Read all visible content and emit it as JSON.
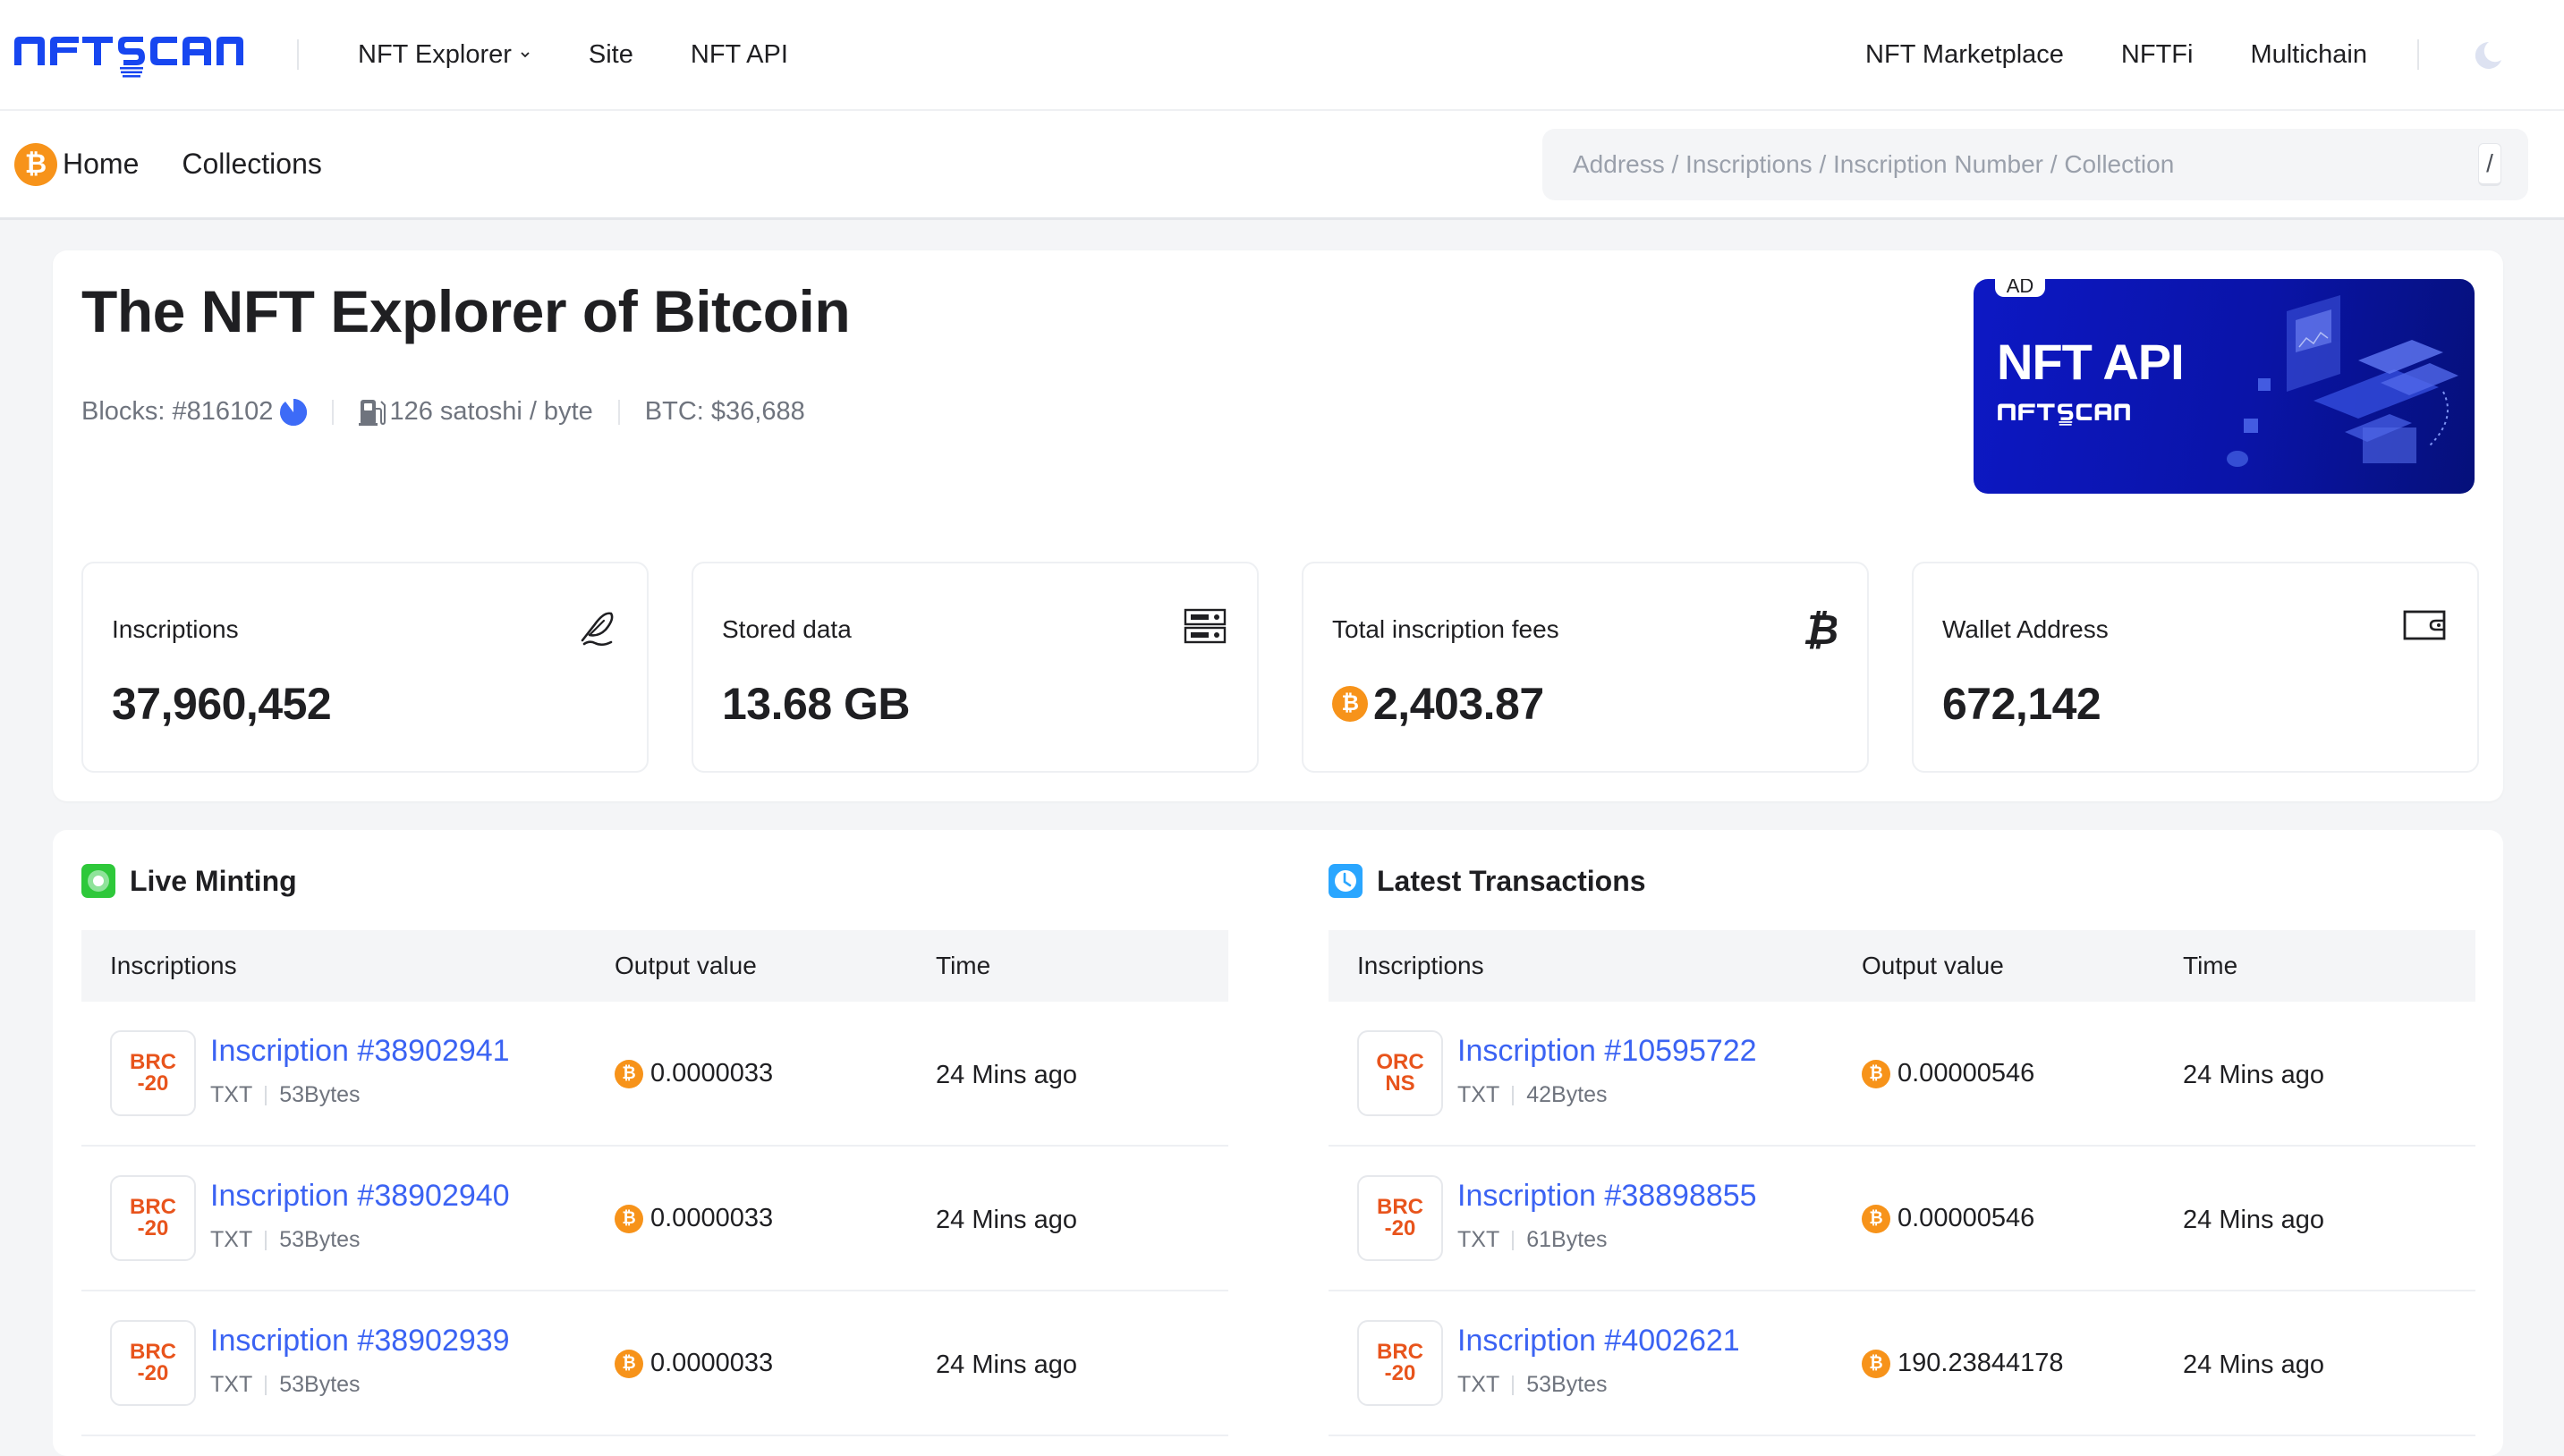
{
  "header": {
    "brand": "NFTSCAN",
    "nav_left": [
      {
        "label": "NFT Explorer",
        "has_dropdown": true
      },
      {
        "label": "Site"
      },
      {
        "label": "NFT API"
      }
    ],
    "nav_right": [
      {
        "label": "NFT Marketplace"
      },
      {
        "label": "NFTFi"
      },
      {
        "label": "Multichain"
      }
    ],
    "theme_toggle_icon": "moon-icon"
  },
  "subnav": {
    "chain_icon": "bitcoin-icon",
    "items": [
      {
        "label": "Home"
      },
      {
        "label": "Collections"
      }
    ],
    "search": {
      "placeholder": "Address / Inscriptions / Inscription Number / Collection",
      "value": "",
      "shortcut": "/"
    }
  },
  "hero": {
    "title": "The NFT Explorer of Bitcoin",
    "stats": {
      "blocks": "Blocks: #816102",
      "gas": "126 satoshi / byte",
      "btc_price": "BTC: $36,688"
    },
    "ad": {
      "tag": "AD",
      "title": "NFT API",
      "brand": "NFTSCAN"
    },
    "cards": [
      {
        "label": "Inscriptions",
        "value": "37,960,452",
        "icon": "quill-icon"
      },
      {
        "label": "Stored data",
        "value": "13.68 GB",
        "icon": "server-icon"
      },
      {
        "label": "Total inscription fees",
        "value": "2,403.87",
        "icon": "bitcoin-symbol-icon",
        "has_btc_coin": true
      },
      {
        "label": "Wallet Address",
        "value": "672,142",
        "icon": "wallet-icon"
      }
    ]
  },
  "live_minting": {
    "title": "Live Minting",
    "columns": [
      "Inscriptions",
      "Output value",
      "Time"
    ],
    "rows": [
      {
        "badge": [
          "BRC",
          "-20"
        ],
        "name": "Inscription #38902941",
        "type": "TXT",
        "size": "53Bytes",
        "output": "0.0000033",
        "time": "24 Mins ago"
      },
      {
        "badge": [
          "BRC",
          "-20"
        ],
        "name": "Inscription #38902940",
        "type": "TXT",
        "size": "53Bytes",
        "output": "0.0000033",
        "time": "24 Mins ago"
      },
      {
        "badge": [
          "BRC",
          "-20"
        ],
        "name": "Inscription #38902939",
        "type": "TXT",
        "size": "53Bytes",
        "output": "0.0000033",
        "time": "24 Mins ago"
      }
    ]
  },
  "latest_transactions": {
    "title": "Latest Transactions",
    "columns": [
      "Inscriptions",
      "Output value",
      "Time"
    ],
    "rows": [
      {
        "badge": [
          "ORC",
          "NS"
        ],
        "name": "Inscription #10595722",
        "type": "TXT",
        "size": "42Bytes",
        "output": "0.00000546",
        "time": "24 Mins ago"
      },
      {
        "badge": [
          "BRC",
          "-20"
        ],
        "name": "Inscription #38898855",
        "type": "TXT",
        "size": "61Bytes",
        "output": "0.00000546",
        "time": "24 Mins ago"
      },
      {
        "badge": [
          "BRC",
          "-20"
        ],
        "name": "Inscription #4002621",
        "type": "TXT",
        "size": "53Bytes",
        "output": "190.23844178",
        "time": "24 Mins ago"
      }
    ]
  },
  "colors": {
    "brand_blue": "#1746f0",
    "link_blue": "#3b63f3",
    "bitcoin_orange": "#f7931a",
    "badge_orange": "#e8541c",
    "live_green": "#2ec83a",
    "clock_blue": "#2aa6ff"
  }
}
